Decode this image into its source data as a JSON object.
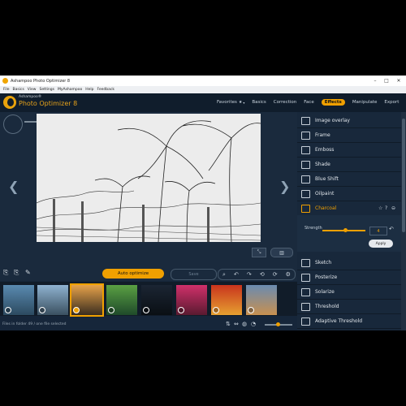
{
  "window": {
    "title": "Ashampoo Photo Optimizer 8"
  },
  "menu": [
    "File",
    "Basics",
    "View",
    "Settings",
    "MyAshampoo",
    "Help",
    "Feedback"
  ],
  "brand": {
    "top": "Ashampoo®",
    "name": "Photo Optimizer 8"
  },
  "nav": {
    "favorites": "Favorites",
    "basics": "Basics",
    "correction": "Correction",
    "face": "Face",
    "effects": "Effects",
    "manipulate": "Manipulate",
    "export": "Export"
  },
  "toolbar": {
    "auto_label": "Auto optimize",
    "save_label": "Save"
  },
  "effects": {
    "items": [
      {
        "label": "Image overlay"
      },
      {
        "label": "Frame"
      },
      {
        "label": "Emboss"
      },
      {
        "label": "Shade"
      },
      {
        "label": "Blue Shift"
      },
      {
        "label": "Oilpaint"
      },
      {
        "label": "Charcoal"
      }
    ],
    "panel": {
      "strength_label": "Strength",
      "strength_value": "4",
      "apply_label": "Apply"
    },
    "more": [
      {
        "label": "Sketch"
      },
      {
        "label": "Posterize"
      },
      {
        "label": "Solarize"
      },
      {
        "label": "Threshold"
      },
      {
        "label": "Adaptive Threshold"
      }
    ]
  },
  "status": {
    "text": "Files in folder 49 / one file selected"
  },
  "colors": {
    "accent": "#f0a000",
    "bg": "#16263a"
  }
}
